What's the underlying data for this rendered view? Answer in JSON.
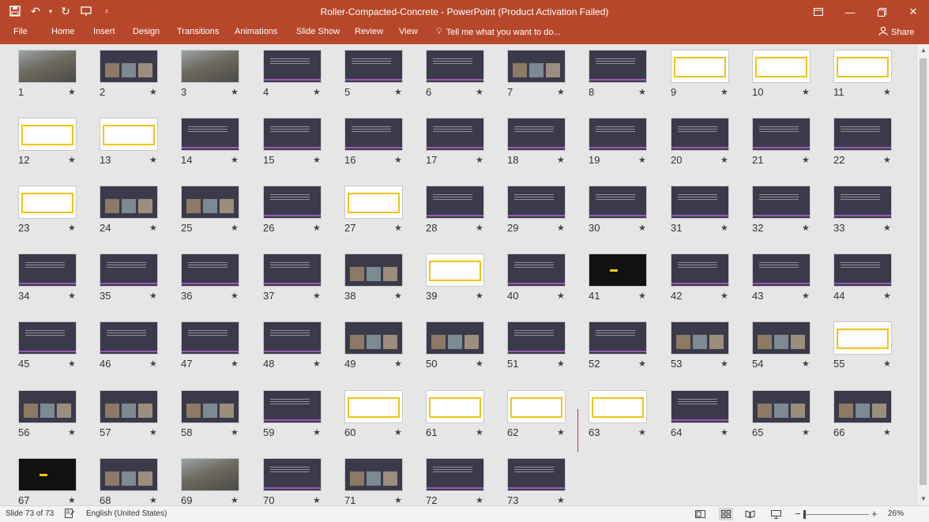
{
  "window": {
    "title": "Roller-Compacted-Concrete - PowerPoint (Product Activation Failed)"
  },
  "qat": {
    "save_icon": "save-icon",
    "undo_icon": "undo-icon",
    "redo_icon": "redo-icon",
    "customize_icon": "customize-icon"
  },
  "ribbon": {
    "tabs": [
      "File",
      "Home",
      "Insert",
      "Design",
      "Transitions",
      "Animations",
      "Slide Show",
      "Review",
      "View"
    ],
    "tell_me": "Tell me what you want to do...",
    "share": "Share"
  },
  "colors": {
    "accent": "#b7472a",
    "slide_dark": "#3b3a4b",
    "slide_stripe": "#9b59b6",
    "highlight": "#f1c40f"
  },
  "slides": [
    {
      "number": "1",
      "style": "photo"
    },
    {
      "number": "2",
      "style": "mixed"
    },
    {
      "number": "3",
      "style": "photo"
    },
    {
      "number": "4",
      "style": "dark"
    },
    {
      "number": "5",
      "style": "dark"
    },
    {
      "number": "6",
      "style": "dark"
    },
    {
      "number": "7",
      "style": "mixed"
    },
    {
      "number": "8",
      "style": "dark"
    },
    {
      "number": "9",
      "style": "light"
    },
    {
      "number": "10",
      "style": "light"
    },
    {
      "number": "11",
      "style": "light"
    },
    {
      "number": "12",
      "style": "light"
    },
    {
      "number": "13",
      "style": "light"
    },
    {
      "number": "14",
      "style": "dark"
    },
    {
      "number": "15",
      "style": "dark"
    },
    {
      "number": "16",
      "style": "dark"
    },
    {
      "number": "17",
      "style": "dark"
    },
    {
      "number": "18",
      "style": "dark"
    },
    {
      "number": "19",
      "style": "dark"
    },
    {
      "number": "20",
      "style": "dark"
    },
    {
      "number": "21",
      "style": "dark"
    },
    {
      "number": "22",
      "style": "dark"
    },
    {
      "number": "23",
      "style": "light"
    },
    {
      "number": "24",
      "style": "mixed"
    },
    {
      "number": "25",
      "style": "mixed"
    },
    {
      "number": "26",
      "style": "dark"
    },
    {
      "number": "27",
      "style": "light"
    },
    {
      "number": "28",
      "style": "dark"
    },
    {
      "number": "29",
      "style": "dark"
    },
    {
      "number": "30",
      "style": "dark"
    },
    {
      "number": "31",
      "style": "dark"
    },
    {
      "number": "32",
      "style": "dark"
    },
    {
      "number": "33",
      "style": "dark"
    },
    {
      "number": "34",
      "style": "dark"
    },
    {
      "number": "35",
      "style": "dark"
    },
    {
      "number": "36",
      "style": "dark"
    },
    {
      "number": "37",
      "style": "dark"
    },
    {
      "number": "38",
      "style": "mixed"
    },
    {
      "number": "39",
      "style": "light"
    },
    {
      "number": "40",
      "style": "dark"
    },
    {
      "number": "41",
      "style": "black"
    },
    {
      "number": "42",
      "style": "dark"
    },
    {
      "number": "43",
      "style": "dark"
    },
    {
      "number": "44",
      "style": "dark"
    },
    {
      "number": "45",
      "style": "dark"
    },
    {
      "number": "46",
      "style": "dark"
    },
    {
      "number": "47",
      "style": "dark"
    },
    {
      "number": "48",
      "style": "dark"
    },
    {
      "number": "49",
      "style": "mixed"
    },
    {
      "number": "50",
      "style": "mixed"
    },
    {
      "number": "51",
      "style": "dark"
    },
    {
      "number": "52",
      "style": "dark"
    },
    {
      "number": "53",
      "style": "mixed"
    },
    {
      "number": "54",
      "style": "mixed"
    },
    {
      "number": "55",
      "style": "light"
    },
    {
      "number": "56",
      "style": "mixed"
    },
    {
      "number": "57",
      "style": "mixed"
    },
    {
      "number": "58",
      "style": "mixed"
    },
    {
      "number": "59",
      "style": "dark"
    },
    {
      "number": "60",
      "style": "light"
    },
    {
      "number": "61",
      "style": "light"
    },
    {
      "number": "62",
      "style": "light"
    },
    {
      "number": "63",
      "style": "light"
    },
    {
      "number": "64",
      "style": "dark"
    },
    {
      "number": "65",
      "style": "mixed"
    },
    {
      "number": "66",
      "style": "mixed"
    },
    {
      "number": "67",
      "style": "black"
    },
    {
      "number": "68",
      "style": "mixed"
    },
    {
      "number": "69",
      "style": "photo"
    },
    {
      "number": "70",
      "style": "dark"
    },
    {
      "number": "71",
      "style": "mixed"
    },
    {
      "number": "72",
      "style": "dark"
    },
    {
      "number": "73",
      "style": "dark"
    }
  ],
  "status": {
    "slide_info": "Slide 73 of 73",
    "language": "English (United States)",
    "zoom": "26%",
    "zoom_fraction": 0.0
  }
}
